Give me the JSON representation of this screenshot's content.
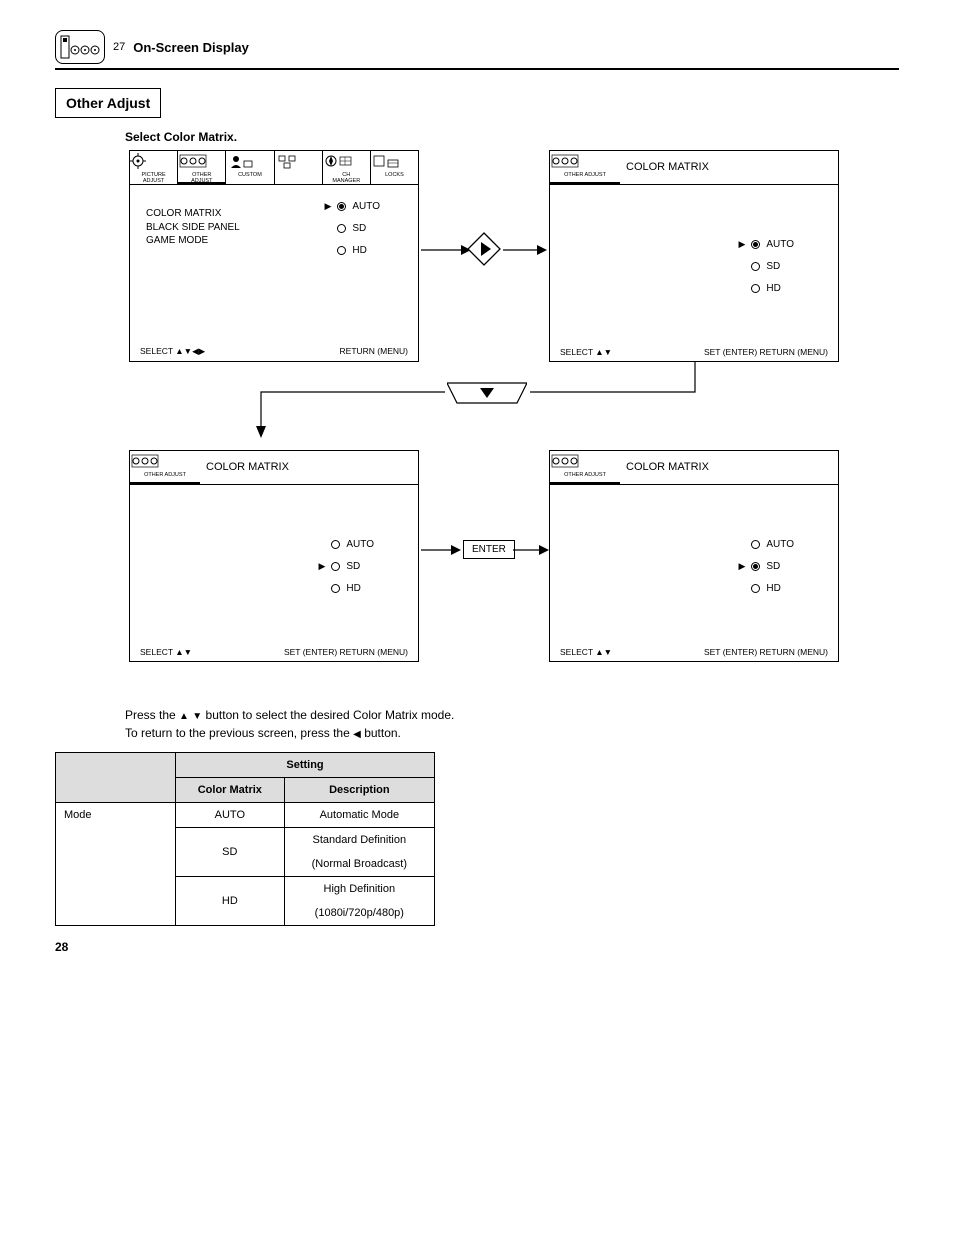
{
  "header": {
    "num": "27",
    "title": "On-Screen Display"
  },
  "section_title": "Other Adjust",
  "subtitle": "Select Color Matrix.",
  "screens": {
    "s1": {
      "tabs": [
        {
          "l1": "PICTURE",
          "l2": "ADJUST"
        },
        {
          "l1": "OTHER",
          "l2": "ADJUST",
          "active": true
        },
        {
          "l1": "CUSTOM",
          "l2": ""
        },
        {
          "l1": " ",
          "l2": ""
        },
        {
          "l1": "CH",
          "l2": "MANAGER"
        },
        {
          "l1": "LOCKS",
          "l2": ""
        }
      ],
      "left": [
        "COLOR MATRIX",
        "BLACK SIDE PANEL",
        "GAME MODE"
      ],
      "opts": [
        {
          "label": "AUTO",
          "sel": true
        },
        {
          "label": "SD",
          "sel": false
        },
        {
          "label": "HD",
          "sel": false
        }
      ],
      "footer_l": "SELECT ▲▼◀▶",
      "footer_r": "RETURN (MENU)"
    },
    "s2": {
      "tab_label": "OTHER ADJUST",
      "title": "COLOR MATRIX",
      "opts": [
        {
          "label": "AUTO",
          "sel": true
        },
        {
          "label": "SD",
          "sel": false
        },
        {
          "label": "HD",
          "sel": false
        }
      ],
      "footer_l": "SELECT ▲▼",
      "footer_r": "SET (ENTER)     RETURN (MENU)"
    },
    "s3": {
      "tab_label": "OTHER ADJUST",
      "title": "COLOR MATRIX",
      "opts": [
        {
          "label": "AUTO",
          "sel": false
        },
        {
          "label": "SD",
          "sel": true
        },
        {
          "label": "HD",
          "sel": false
        }
      ],
      "footer_l": "SELECT ▲▼",
      "footer_r": "SET (ENTER)     RETURN (MENU)"
    },
    "s4": {
      "tab_label": "OTHER ADJUST",
      "title": "COLOR MATRIX",
      "opts": [
        {
          "label": "AUTO",
          "sel": false
        },
        {
          "label": "SD",
          "sel": true
        },
        {
          "label": "HD",
          "sel": false
        }
      ],
      "footer_l": "SELECT ▲▼",
      "footer_r": "SET (ENTER)     RETURN (MENU)"
    }
  },
  "enter_label": "ENTER",
  "instructions": {
    "line1_a": "Press the",
    "line1_b": "button to select the desired Color Matrix mode.",
    "line2_a": "To return to the previous screen, press the",
    "line2_b": "button."
  },
  "table": {
    "head_top": "Setting",
    "cols": [
      "Color Matrix",
      "Description"
    ],
    "mode_label": "Mode",
    "rows": [
      {
        "c1": "AUTO",
        "c2": "Automatic Mode"
      },
      {
        "c1": "SD",
        "c2": "Standard Definition"
      },
      {
        "c1": "",
        "c2": "(Normal Broadcast)"
      },
      {
        "c1": "HD",
        "c2": "High Definition"
      },
      {
        "c1": "",
        "c2": "(1080i/720p/480p)"
      }
    ]
  },
  "page_number": "28"
}
